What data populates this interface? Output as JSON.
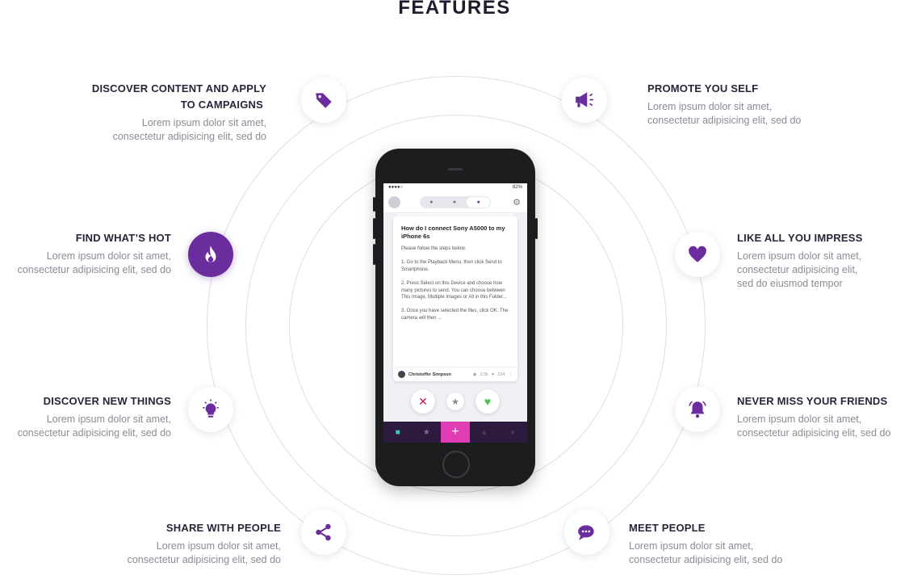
{
  "page": {
    "title": "FEATURES"
  },
  "colors": {
    "accent": "#6b2d9e",
    "text": "#2a2439",
    "muted": "#8d8a96",
    "ring": "#dedde3",
    "pink": "#e03cb4"
  },
  "features": {
    "discover_content": {
      "title_line1": "DISCOVER CONTENT AND APPLY",
      "title_line2": "TO CAMPAIGNS",
      "desc": "Lorem ipsum dolor sit amet,\nconsectetur adipisicing elit, sed do",
      "icon": "tag-icon"
    },
    "find_hot": {
      "title": "FIND WHAT’S HOT",
      "desc": "Lorem ipsum dolor sit amet,\nconsectetur adipisicing elit, sed do",
      "icon": "flame-icon"
    },
    "discover_new": {
      "title": "DISCOVER NEW THINGS",
      "desc": "Lorem ipsum dolor sit amet,\nconsectetur adipisicing elit, sed do",
      "icon": "lightbulb-icon"
    },
    "share": {
      "title": "SHARE WITH PEOPLE",
      "desc": "Lorem ipsum dolor sit amet,\nconsectetur adipisicing elit, sed do",
      "icon": "share-icon"
    },
    "promote": {
      "title": "PROMOTE YOU SELF",
      "desc": "Lorem ipsum dolor sit amet,\nconsectetur adipisicing elit, sed do",
      "icon": "megaphone-icon"
    },
    "like": {
      "title": "LIKE ALL YOU IMPRESS",
      "desc": "Lorem ipsum dolor sit amet,\nconsectetur adipisicing elit,\nsed do eiusmod tempor",
      "icon": "heart-icon"
    },
    "never_miss": {
      "title": "NEVER MISS YOUR FRIENDS",
      "desc": "Lorem ipsum dolor sit amet,\nconsectetur adipisicing elit, sed do",
      "icon": "bell-icon"
    },
    "meet": {
      "title": "MEET PEOPLE",
      "desc": "Lorem ipsum dolor sit amet,\nconsectetur adipisicing elit, sed do",
      "icon": "chat-icon"
    }
  },
  "phone": {
    "status_left": "●●●●○",
    "status_right": "82%",
    "card_title": "How do I connect Sony A5000 to my iPhone 6s",
    "card_body": "Please follow the steps below.\n\n 1.  Go to the Playback Menu, then click Send to Smartphone.\n\n 2. Press Select on this Device and choose how many pictures to send. You can choose between This Image, Multiple Images or All in this Folder...\n\n 3. Once you have selected the files, click OK. The camera will then ...",
    "author": "Christoffer Simpson",
    "views": "2,5k",
    "likes": "124"
  }
}
